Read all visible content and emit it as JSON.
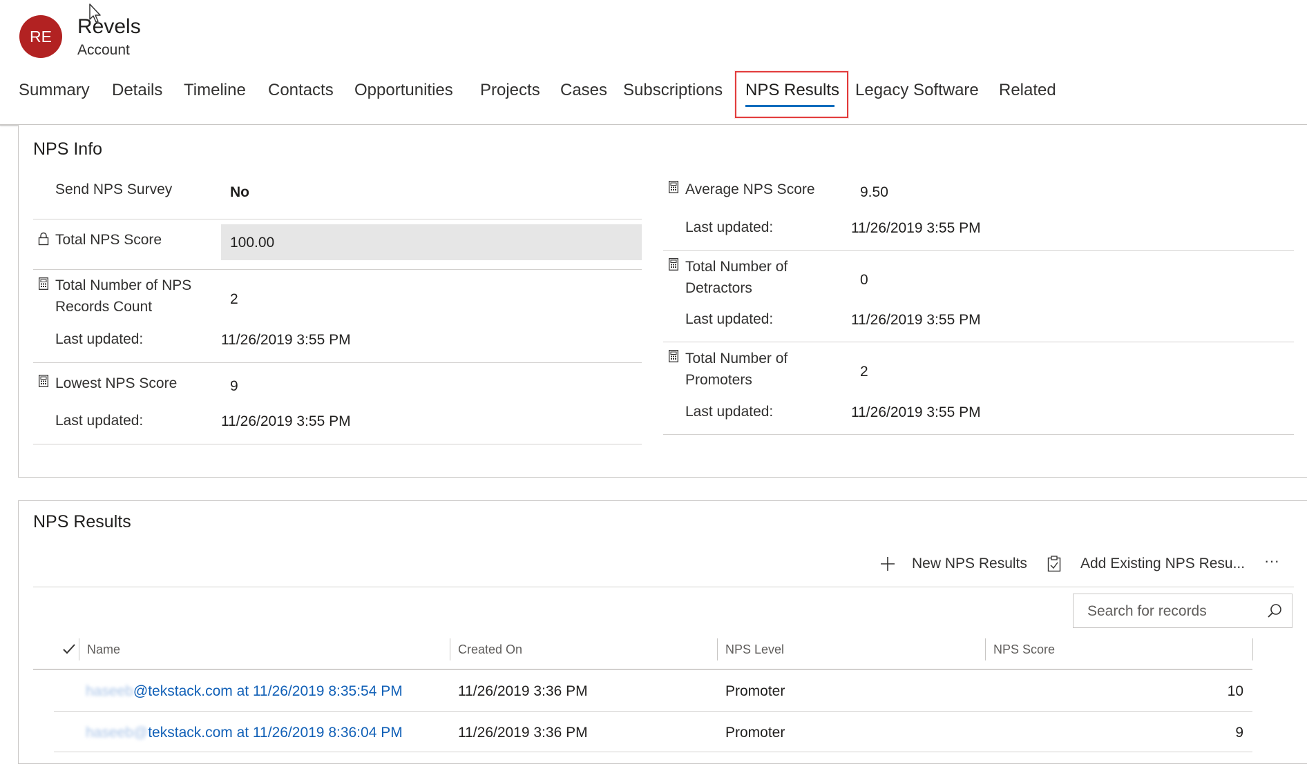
{
  "record": {
    "avatar_initials": "RE",
    "title": "Revels",
    "entity": "Account"
  },
  "tabs": [
    {
      "label": "Summary"
    },
    {
      "label": "Details"
    },
    {
      "label": "Timeline"
    },
    {
      "label": "Contacts"
    },
    {
      "label": "Opportunities"
    },
    {
      "label": "Projects"
    },
    {
      "label": "Cases"
    },
    {
      "label": "Subscriptions"
    },
    {
      "label": "NPS Results",
      "active": true
    },
    {
      "label": "Legacy Software"
    },
    {
      "label": "Related"
    }
  ],
  "nps_info": {
    "title": "NPS Info",
    "send_survey": {
      "label": "Send NPS Survey",
      "value": "No"
    },
    "total_score": {
      "label": "Total NPS Score",
      "value": "100.00",
      "icon": "lock-icon"
    },
    "records_count": {
      "label_line1": "Total Number of NPS",
      "label_line2": "Records Count",
      "value": "2",
      "updated_label": "Last updated:",
      "updated_value": "11/26/2019 3:55 PM",
      "icon": "calculator-icon"
    },
    "lowest_score": {
      "label": "Lowest NPS Score",
      "value": "9",
      "updated_label": "Last updated:",
      "updated_value": "11/26/2019 3:55 PM",
      "icon": "calculator-icon"
    },
    "average_score": {
      "label": "Average NPS Score",
      "value": "9.50",
      "updated_label": "Last updated:",
      "updated_value": "11/26/2019 3:55 PM",
      "icon": "calculator-icon"
    },
    "detractors": {
      "label_line1": "Total Number of",
      "label_line2": "Detractors",
      "value": "0",
      "updated_label": "Last updated:",
      "updated_value": "11/26/2019 3:55 PM",
      "icon": "calculator-icon"
    },
    "promoters": {
      "label_line1": "Total Number of",
      "label_line2": "Promoters",
      "value": "2",
      "updated_label": "Last updated:",
      "updated_value": "11/26/2019 3:55 PM",
      "icon": "calculator-icon"
    }
  },
  "nps_results": {
    "title": "NPS Results",
    "commands": {
      "new_label": "New NPS Results",
      "add_existing_label": "Add Existing NPS Resu...",
      "more_label": "···"
    },
    "search": {
      "placeholder": "Search for records"
    },
    "columns": [
      "Name",
      "Created On",
      "NPS Level",
      "NPS Score"
    ],
    "rows": [
      {
        "name_hidden": "haseeb",
        "name": "@tekstack.com at 11/26/2019 8:35:54 PM",
        "created_on": "11/26/2019 3:36 PM",
        "level": "Promoter",
        "score": "10"
      },
      {
        "name_hidden": "haseeb@",
        "name": "tekstack.com at 11/26/2019 8:36:04 PM",
        "created_on": "11/26/2019 3:36 PM",
        "level": "Promoter",
        "score": "9"
      }
    ]
  }
}
